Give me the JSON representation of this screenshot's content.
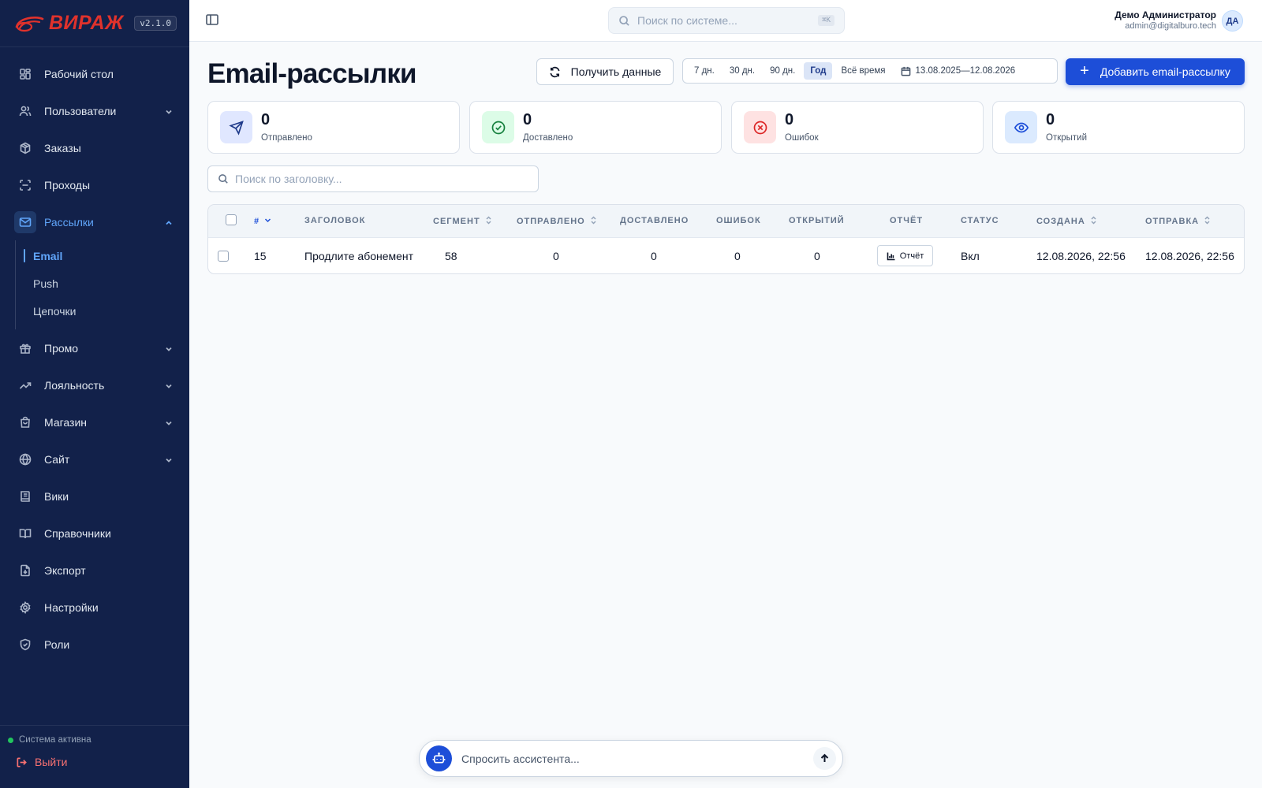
{
  "brand": {
    "name": "ВИРАЖ",
    "version": "v2.1.0",
    "accent": "#e0322c"
  },
  "sidebar": {
    "items": [
      {
        "label": "Рабочий стол",
        "icon": "dashboard-icon"
      },
      {
        "label": "Пользователи",
        "icon": "users-icon",
        "expandable": true
      },
      {
        "label": "Заказы",
        "icon": "box-icon"
      },
      {
        "label": "Проходы",
        "icon": "scan-icon"
      },
      {
        "label": "Рассылки",
        "icon": "mail-icon",
        "expanded": true,
        "active": true
      },
      {
        "label": "Промо",
        "icon": "gift-icon",
        "expandable": true
      },
      {
        "label": "Лояльность",
        "icon": "trending-icon",
        "expandable": true
      },
      {
        "label": "Магазин",
        "icon": "shopping-bag-icon",
        "expandable": true
      },
      {
        "label": "Сайт",
        "icon": "globe-icon",
        "expandable": true
      },
      {
        "label": "Вики",
        "icon": "book-text-icon"
      },
      {
        "label": "Справочники",
        "icon": "book-open-icon"
      },
      {
        "label": "Экспорт",
        "icon": "file-export-icon"
      },
      {
        "label": "Настройки",
        "icon": "gear-icon"
      },
      {
        "label": "Роли",
        "icon": "shield-icon"
      }
    ],
    "subitems": [
      {
        "label": "Email",
        "active": true
      },
      {
        "label": "Push"
      },
      {
        "label": "Цепочки"
      }
    ],
    "status_text": "Система активна",
    "logout_label": "Выйти"
  },
  "topbar": {
    "search_placeholder": "Поиск по системе...",
    "search_shortcut": "⌘K",
    "user_name": "Демо Администратор",
    "user_email": "admin@digitalburo.tech",
    "avatar_initials": "ДА"
  },
  "page": {
    "title": "Email-рассылки",
    "fetch_label": "Получить данные",
    "periods": [
      "7 дн.",
      "30 дн.",
      "90 дн.",
      "Год",
      "Всё время"
    ],
    "selected_period": "Год",
    "date_range": "13.08.2025—12.08.2026",
    "add_label": "Добавить email-рассылку"
  },
  "stats": [
    {
      "value": "0",
      "label": "Отправлено",
      "icon": "send-icon",
      "bg": "#e0e7ff",
      "color": "#1e3a8a"
    },
    {
      "value": "0",
      "label": "Доставлено",
      "icon": "check-circle-icon",
      "bg": "#dcfce7",
      "color": "#15803d"
    },
    {
      "value": "0",
      "label": "Ошибок",
      "icon": "x-circle-icon",
      "bg": "#fee2e2",
      "color": "#dc2626"
    },
    {
      "value": "0",
      "label": "Открытий",
      "icon": "eye-icon",
      "bg": "#dbeafe",
      "color": "#1d4ed8"
    }
  ],
  "table": {
    "search_placeholder": "Поиск по заголовку...",
    "columns": [
      "#",
      "ЗАГОЛОВОК",
      "СЕГМЕНТ",
      "ОТПРАВЛЕНО",
      "ДОСТАВЛЕНО",
      "ОШИБОК",
      "ОТКРЫТИЙ",
      "ОТЧЁТ",
      "СТАТУС",
      "СОЗДАНА",
      "ОТПРАВКА"
    ],
    "rows": [
      {
        "id": "15",
        "title": "Продлите абонемент",
        "segment": "58",
        "sent": "0",
        "delivered": "0",
        "errors": "0",
        "opens": "0",
        "report_label": "Отчёт",
        "status": "Вкл",
        "created": "12.08.2026, 22:56",
        "send_at": "12.08.2026, 22:56"
      }
    ]
  },
  "assistant": {
    "placeholder": "Спросить ассистента..."
  }
}
